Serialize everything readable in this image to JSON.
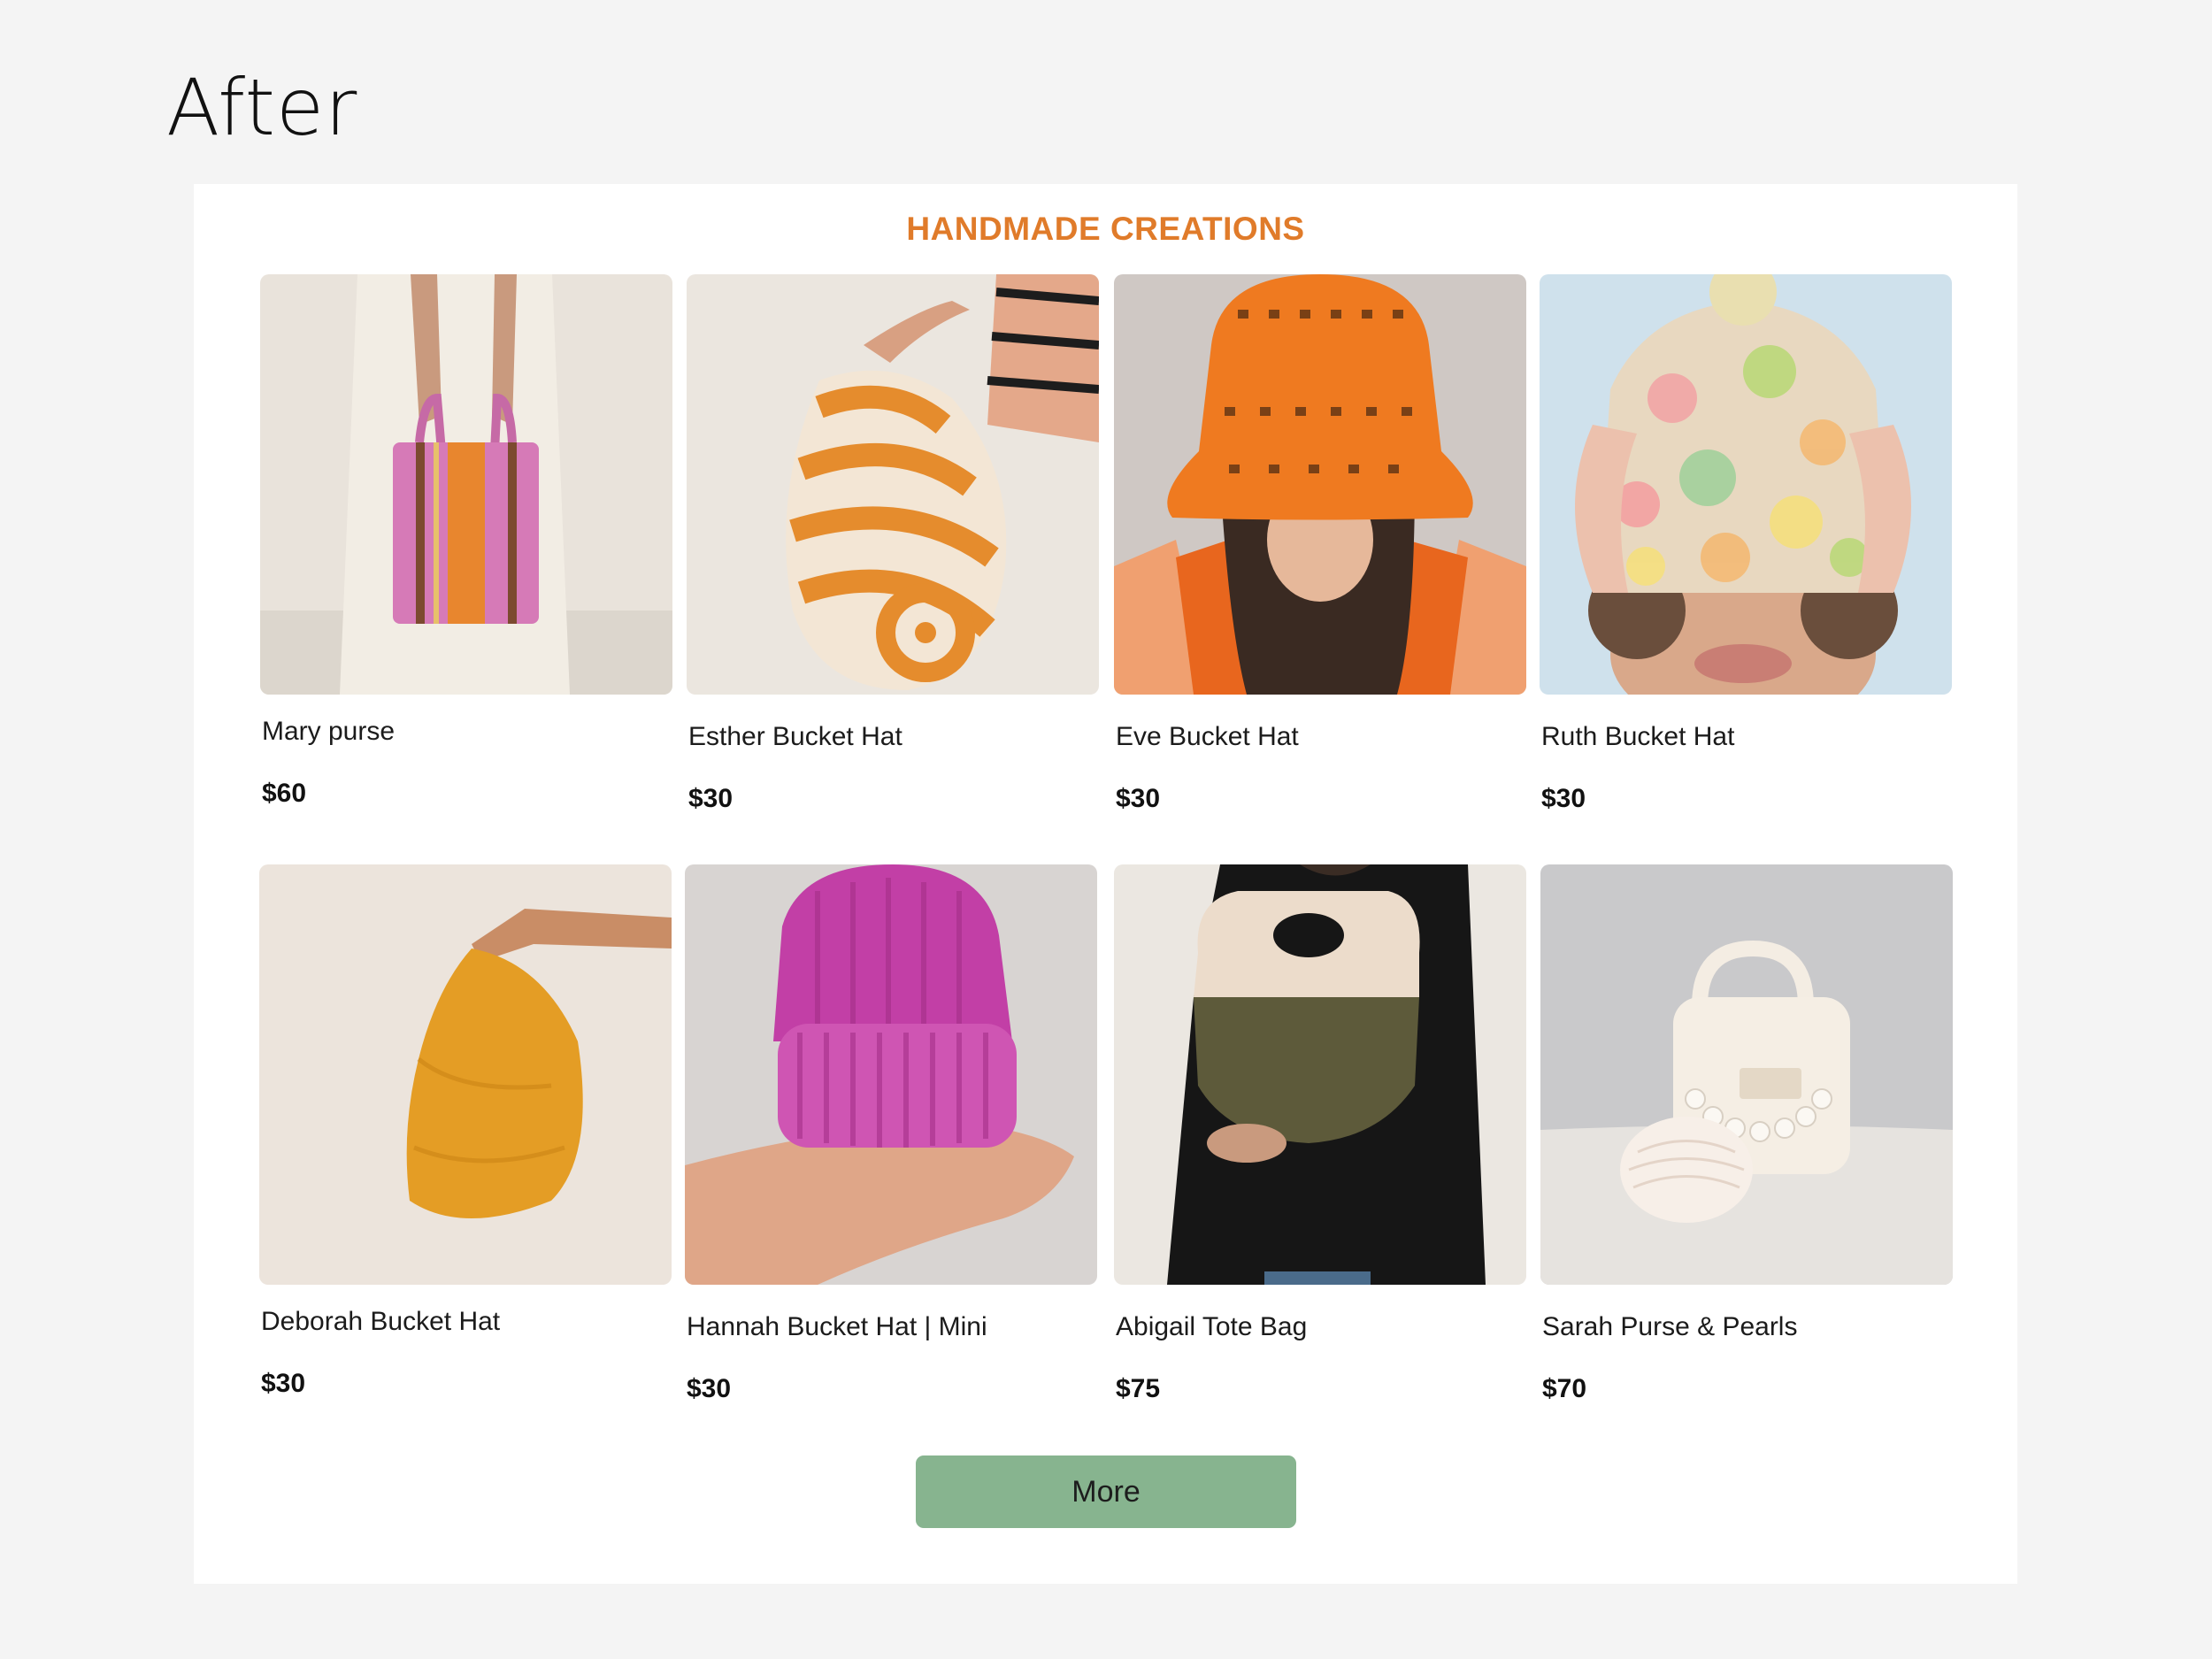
{
  "page_label": "After",
  "section": {
    "title": "HANDMADE CREATIONS"
  },
  "products": [
    {
      "name": "Mary purse",
      "price": "$60",
      "image": "pink-striped-crochet-purse"
    },
    {
      "name": "Esther Bucket Hat",
      "price": "$30",
      "image": "orange-striped-bucket-hat"
    },
    {
      "name": "Eve Bucket Hat",
      "price": "$30",
      "image": "orange-crochet-bucket-hat"
    },
    {
      "name": "Ruth Bucket Hat",
      "price": "$30",
      "image": "multicolor-knit-beanie"
    },
    {
      "name": "Deborah Bucket Hat",
      "price": "$30",
      "image": "mustard-crochet-bucket-hat"
    },
    {
      "name": "Hannah Bucket Hat | Mini",
      "price": "$30",
      "image": "magenta-knit-beanie"
    },
    {
      "name": "Abigail Tote Bag",
      "price": "$75",
      "image": "olive-cream-tote-bag"
    },
    {
      "name": "Sarah Purse & Pearls",
      "price": "$70",
      "image": "cream-purse-with-pearls"
    }
  ],
  "more_button": {
    "label": "More"
  },
  "colors": {
    "page_background": "#f4f4f4",
    "panel_background": "#ffffff",
    "title": "#e07b2a",
    "button": "#87b48f"
  }
}
